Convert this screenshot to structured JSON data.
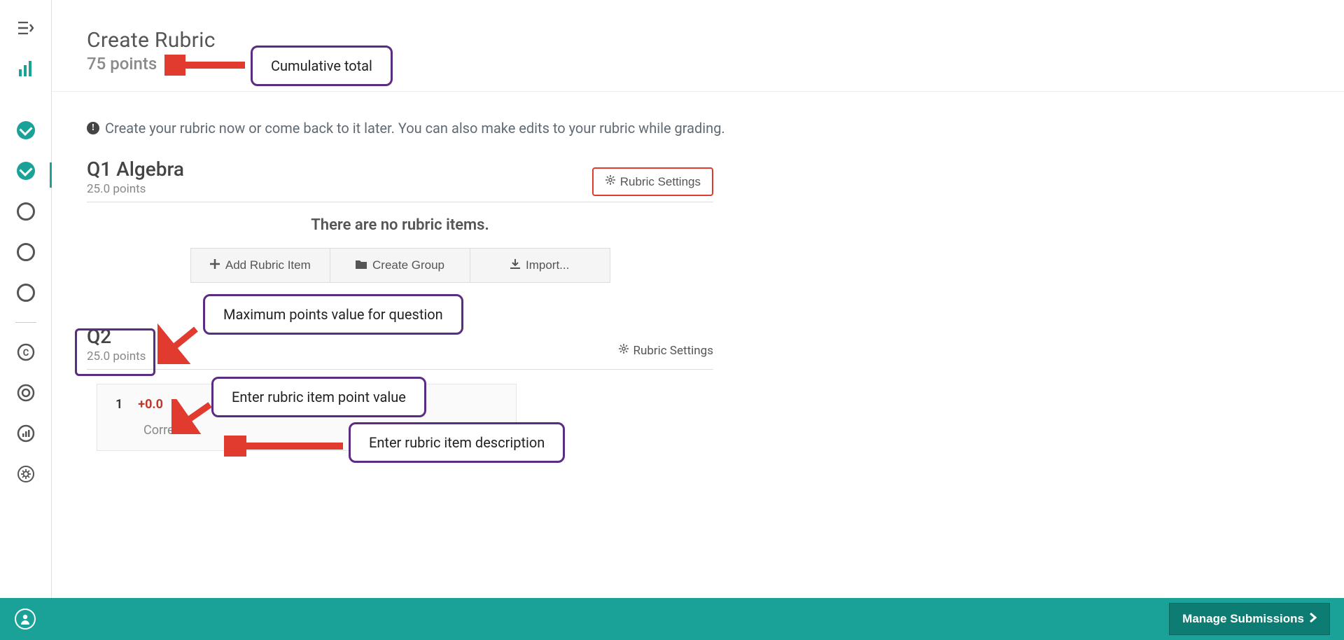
{
  "header": {
    "title": "Create Rubric",
    "points_total": "75 points"
  },
  "info": {
    "text": "Create your rubric now or come back to it later. You can also make edits to your rubric while grading."
  },
  "q1": {
    "title": "Q1 Algebra",
    "points": "25.0 points",
    "settings_label": "Rubric Settings",
    "no_items": "There are no rubric items.",
    "add_item": "Add Rubric Item",
    "create_group": "Create Group",
    "import": "Import..."
  },
  "q2": {
    "title": "Q2",
    "points": "25.0 points",
    "settings_label": "Rubric Settings",
    "item": {
      "index": "1",
      "points": "+0.0",
      "desc": "Correct"
    }
  },
  "annotations": {
    "cumulative": "Cumulative total",
    "max_points": "Maximum points value for question",
    "item_points": "Enter rubric item point value",
    "item_desc": "Enter rubric item description"
  },
  "footer": {
    "manage": "Manage Submissions"
  },
  "sidebar": {
    "icons": [
      "menu",
      "stats",
      "check",
      "check",
      "circle",
      "circle",
      "circle",
      "copyright",
      "target",
      "barcircle",
      "gear",
      "user"
    ]
  }
}
